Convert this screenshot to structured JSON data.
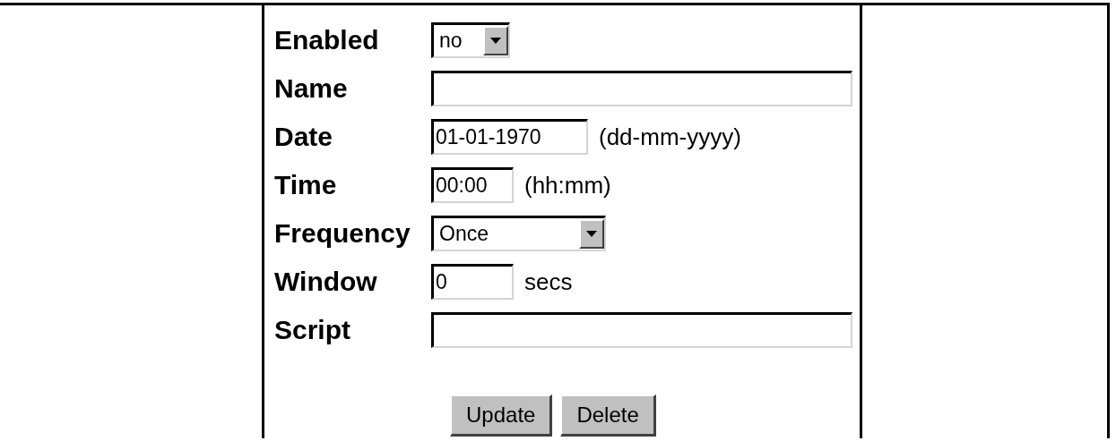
{
  "form": {
    "fields": [
      {
        "kind": "select",
        "label": "Enabled",
        "value": "no"
      },
      {
        "kind": "text",
        "label": "Name"
      },
      {
        "kind": "text",
        "label": "Date",
        "value": "01-01-1970",
        "hint": "(dd-mm-yyyy)"
      },
      {
        "kind": "text",
        "label": "Time",
        "value": "00:00",
        "hint": "(hh:mm)"
      },
      {
        "kind": "select",
        "label": "Frequency",
        "value": "Once"
      },
      {
        "kind": "text",
        "label": "Window",
        "value": "0",
        "hint": "secs"
      },
      {
        "kind": "text",
        "label": "Script"
      }
    ],
    "buttons": [
      "Update",
      "Delete"
    ]
  }
}
